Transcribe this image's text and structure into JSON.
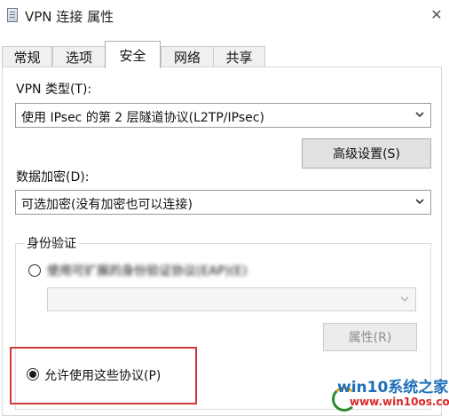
{
  "window": {
    "title": "VPN 连接 属性",
    "close_glyph": "✕"
  },
  "tabs": [
    {
      "label": "常规"
    },
    {
      "label": "选项"
    },
    {
      "label": "安全"
    },
    {
      "label": "网络"
    },
    {
      "label": "共享"
    }
  ],
  "active_tab": "安全",
  "vpn_type": {
    "label": "VPN 类型(T):",
    "value": "使用 IPsec 的第 2 层隧道协议(L2TP/IPsec)"
  },
  "advanced_button": {
    "label": "高级设置(S)"
  },
  "data_encryption": {
    "label": "数据加密(D):",
    "value": "可选加密(没有加密也可以连接)"
  },
  "authentication": {
    "group_title": "身份验证",
    "eap_option": {
      "label": "使用可扩展的身份验证协议(EAP)(E)",
      "checked": false
    },
    "eap_select": {
      "value": ""
    },
    "properties_button": {
      "label": "属性(R)",
      "disabled": true
    },
    "allow_protocols_option": {
      "label": "允许使用这些协议(P)",
      "checked": true
    }
  },
  "watermark": {
    "line1": "win10系统之家",
    "line2": "www.win10os.com"
  },
  "colors": {
    "highlight": "#d23a3a",
    "watermark_blue": "#1d6fb8",
    "watermark_red": "#d9262b"
  }
}
